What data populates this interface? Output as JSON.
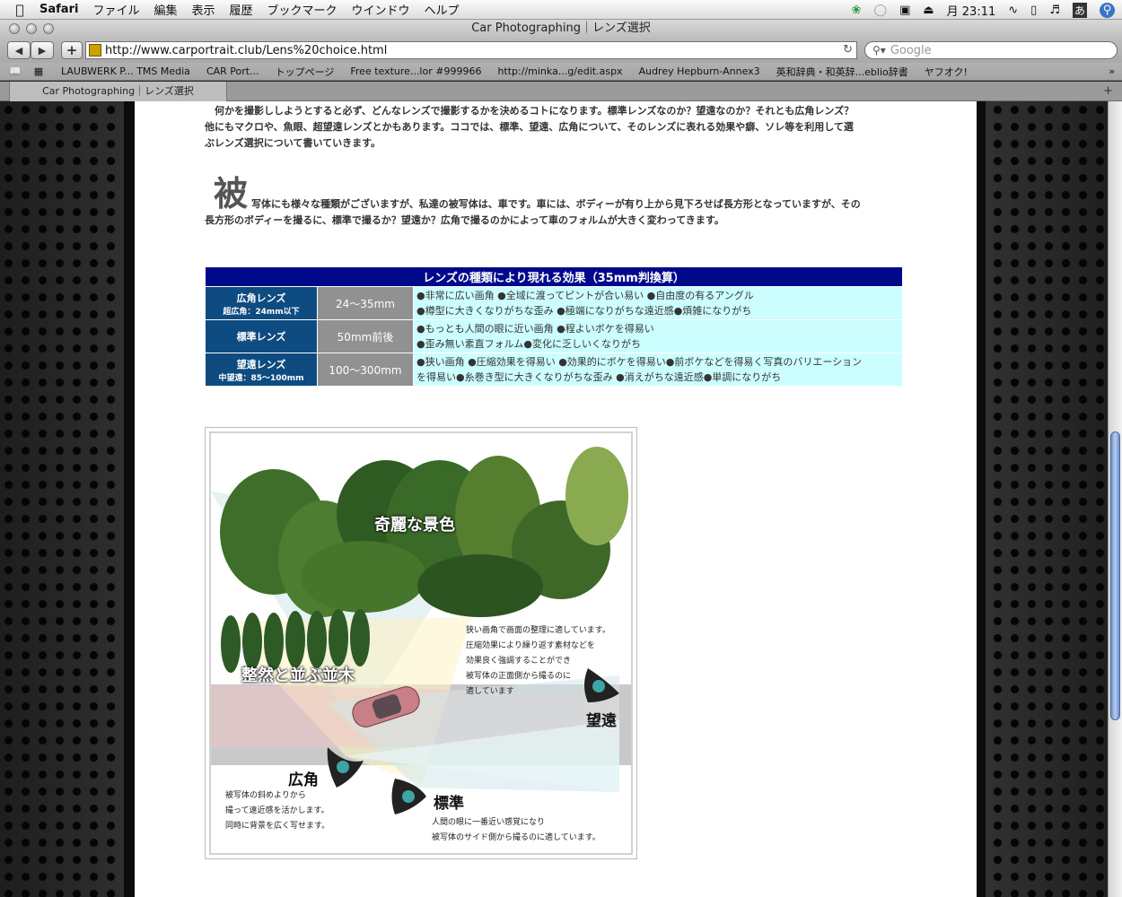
{
  "menubar": {
    "app": "Safari",
    "items": [
      "ファイル",
      "編集",
      "表示",
      "履歴",
      "ブックマーク",
      "ウインドウ",
      "ヘルプ"
    ],
    "clock": "月 23:11",
    "input_method": "あ"
  },
  "window": {
    "title": "Car Photographing｜レンズ選択"
  },
  "toolbar": {
    "url": "http://www.carportrait.club/Lens%20choice.html",
    "search_placeholder": "Google"
  },
  "bookmarks": [
    "LAUBWERK P... TMS Media",
    "CAR Port...",
    "トップページ",
    "Free texture...lor #999966",
    "http://minka...g/edit.aspx",
    "Audrey Hepburn-Annex3",
    "英和辞典・和英辞...eblio辞書",
    "ヤフオク!"
  ],
  "tab": {
    "label": "Car Photographing｜レンズ選択"
  },
  "content": {
    "intro_lines": [
      "　何かを撮影ししようとすると必ず、どんなレンズで撮影するかを決めるコトになります。標準レンズなのか？望遠なのか？それとも広角レンズ？",
      "他にもマクロや、魚眼、超望遠レンズとかもあります。ココでは、標準、望遠、広角について、そのレンズに表れる効果や癖、ソレ等を利用して選",
      "ぶレンズ選択について書いていきます。"
    ],
    "dropcap": "被",
    "subject_lines": [
      "写体にも様々な種類がございますが、私達の被写体は、車です。車には、ボディーが有り上から見下ろせば長方形となっていますが、その",
      "長方形のボディーを撮るに、標準で撮るか？望遠か？広角で撮るのかによって車のフォルムが大きく変わってきます。"
    ],
    "table": {
      "title": "レンズの種類により現れる効果（35mm判換算）",
      "rows": [
        {
          "name": "広角レンズ",
          "sub": "超広角：24mm以下",
          "mm": "24～35mm",
          "effects": [
            "●非常に広い画角 ●全域に渡ってピントが合い易い ●自由度の有るアングル",
            "●樽型に大きくなりがちな歪み ●極端になりがちな遠近感●煩雑になりがち"
          ]
        },
        {
          "name": "標準レンズ",
          "sub": "",
          "mm": "50mm前後",
          "effects": [
            "●もっとも人間の眼に近い画角 ●程よいボケを得易い",
            "●歪み無い素直フォルム●変化に乏しいくなりがち"
          ]
        },
        {
          "name": "望遠レンズ",
          "sub": "中望遠：85～100mm",
          "mm": "100～300mm",
          "effects": [
            "●狭い画角 ●圧縮効果を得易い ●効果的にボケを得易い●前ボケなどを得易く写真のバリエーション",
            "を得易い●糸巻き型に大きくなりがちな歪み ●消えがちな遠近感●単調になりがち"
          ]
        }
      ]
    },
    "illustration": {
      "scenery_label": "奇麗な景色",
      "trees_label": "整然と並ぶ並木",
      "tele_label": "望遠",
      "wide_label": "広角",
      "standard_label": "標準",
      "tele_note": [
        "狭い画角で画面の整理に適しています。",
        "圧縮効果により繰り返す素材などを",
        "効果良く強調することができ",
        "被写体の正面側から撮るのに",
        "適しています"
      ],
      "wide_note": [
        "被写体の斜めよりから",
        "撮って遠近感を活かします。",
        "同時に背景を広く写せます。"
      ],
      "standard_note": [
        "人間の眼に一番近い感覚になり",
        "被写体のサイド側から撮るのに適しています。"
      ]
    }
  }
}
